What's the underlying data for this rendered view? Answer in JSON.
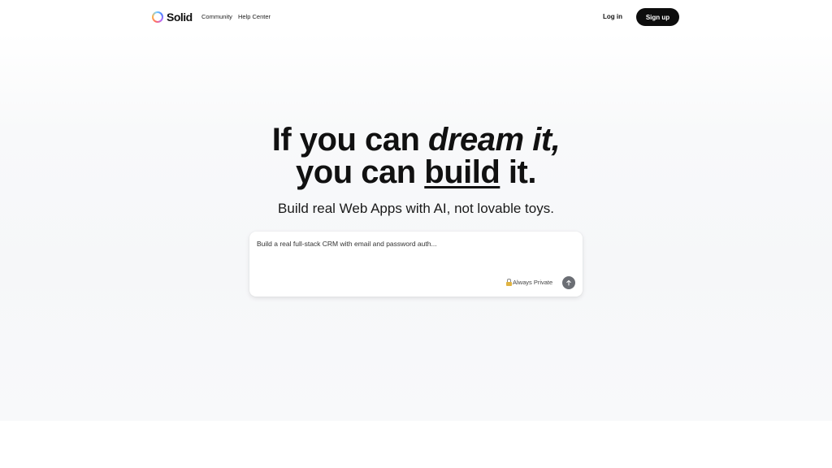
{
  "brand": {
    "name": "Solid"
  },
  "nav": {
    "links": [
      "Community",
      "Help Center"
    ],
    "login_label": "Log in",
    "signup_label": "Sign up"
  },
  "hero": {
    "line1_prefix": "If you can ",
    "line1_emphasis": "dream it,",
    "line2_prefix": "you can ",
    "line2_underlined": "build",
    "line2_suffix": " it.",
    "subheading": "Build real Web Apps with AI, not lovable toys."
  },
  "prompt": {
    "placeholder": "Build a real full-stack CRM with email and password auth...",
    "privacy_label": "Always Private",
    "icons": {
      "privacy": "lock-icon",
      "send": "arrow-up-icon"
    }
  },
  "colors": {
    "signup_bg": "#0d0d0d",
    "send_bg": "#6b6e74",
    "hero_bg": "#f6f7f9"
  }
}
